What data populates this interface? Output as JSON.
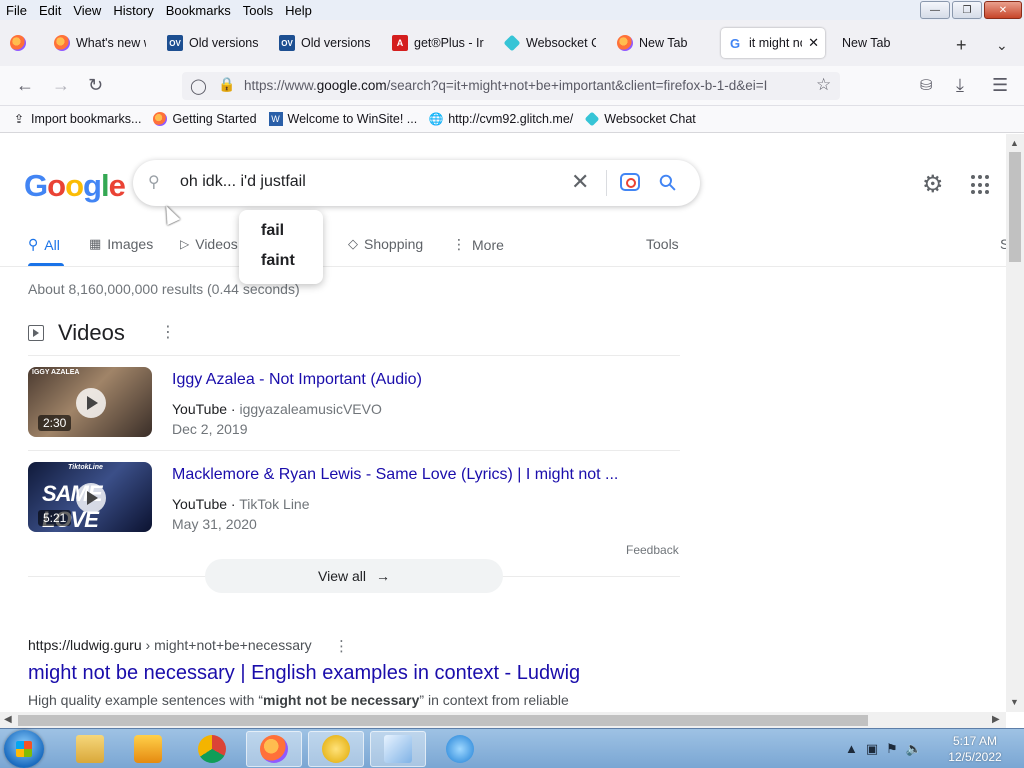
{
  "menu": {
    "items": [
      "File",
      "Edit",
      "View",
      "History",
      "Bookmarks",
      "Tools",
      "Help"
    ]
  },
  "tabs": [
    {
      "label": "",
      "icon": "firefox-icon"
    },
    {
      "label": "What's new w",
      "icon": "firefox-icon"
    },
    {
      "label": "Old versions",
      "icon": "oldversion-icon"
    },
    {
      "label": "Old versions",
      "icon": "oldversion-icon"
    },
    {
      "label": "get®Plus - Ir",
      "icon": "acrobat-icon"
    },
    {
      "label": "Websocket C",
      "icon": "websocket-icon"
    },
    {
      "label": "New Tab",
      "icon": "firefox-icon"
    },
    {
      "label": "it might no",
      "icon": "google-icon",
      "active": true
    },
    {
      "label": "New Tab",
      "icon": ""
    }
  ],
  "nav": {
    "url_prefix": "https://www.",
    "url_domain": "google.com",
    "url_rest": "/search?q=it+might+not+be+important&client=firefox-b-1-d&ei=I"
  },
  "bookmarks": [
    {
      "label": "Import bookmarks...",
      "icon": "import-icon"
    },
    {
      "label": "Getting Started",
      "icon": "firefox-icon"
    },
    {
      "label": "Welcome to WinSite! ...",
      "icon": "winsite-icon"
    },
    {
      "label": "http://cvm92.glitch.me/",
      "icon": "globe-icon"
    },
    {
      "label": "Websocket Chat",
      "icon": "websocket-icon"
    }
  ],
  "search": {
    "query": "oh idk... i'd justfail",
    "suggestions": [
      "fail",
      "faint"
    ]
  },
  "search_tabs": [
    {
      "label": "All",
      "active": true
    },
    {
      "label": "Images"
    },
    {
      "label": "Videos"
    },
    {
      "label": "Shopping"
    },
    {
      "label": "More"
    },
    {
      "label": "Tools"
    },
    {
      "label": "S"
    }
  ],
  "stats": "About 8,160,000,000 results (0.44 seconds)",
  "videos": {
    "heading": "Videos",
    "items": [
      {
        "title": "Iggy Azalea - Not Important (Audio)",
        "source": "YouTube",
        "channel": "iggyazaleamusicVEVO",
        "date": "Dec 2, 2019",
        "duration": "2:30",
        "thumb_text": "IGGY AZALEA",
        "thumb_big": ""
      },
      {
        "title": "Macklemore & Ryan Lewis - Same Love (Lyrics) | I might not ...",
        "source": "YouTube",
        "channel": "TikTok Line",
        "date": "May 31, 2020",
        "duration": "5:21",
        "thumb_text": "TiktokLine",
        "thumb_big": "SAME LOVE"
      }
    ],
    "feedback": "Feedback",
    "view_all": "View all"
  },
  "result": {
    "url": "https://ludwig.guru",
    "path": " › might+not+be+necessary",
    "title": "might not be necessary | English examples in context - Ludwig",
    "snippet_pre": "High quality example sentences with “",
    "snippet_bold": "might not be necessary",
    "snippet_post": "” in context from reliable"
  },
  "taskbar": {
    "time": "5:17 AM",
    "date": "12/5/2022"
  },
  "colors": {
    "link": "#1a0dab",
    "accent": "#1a73e8",
    "google_blue": "#4285f4",
    "google_red": "#ea4335",
    "google_yellow": "#fbbc05",
    "google_green": "#34a853"
  }
}
